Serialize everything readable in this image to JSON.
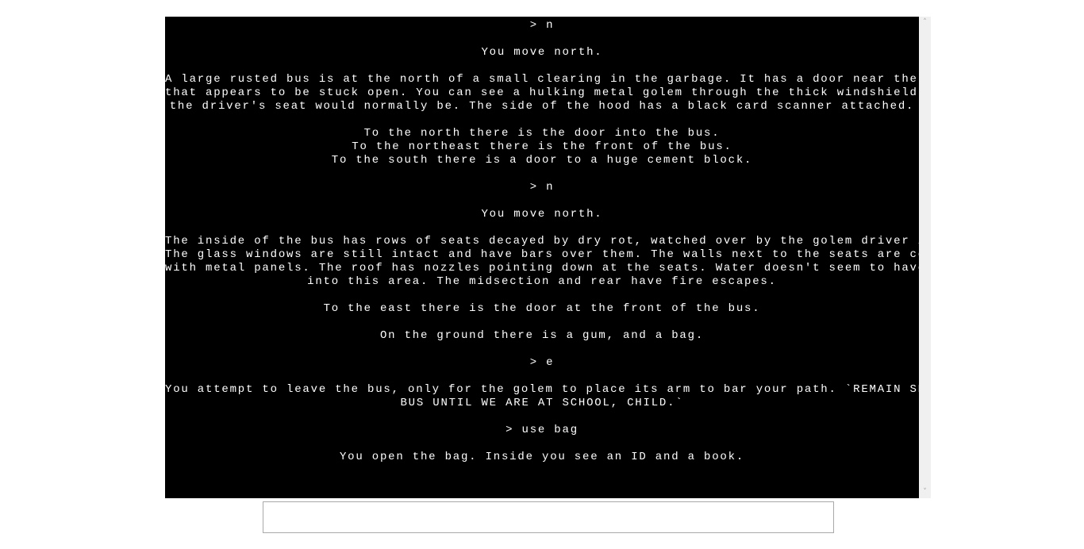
{
  "output": [
    {
      "kind": "command",
      "lines": [
        "> n"
      ]
    },
    {
      "kind": "text",
      "lines": [
        "You move north."
      ]
    },
    {
      "kind": "text",
      "lines": [
        "A large rusted bus is at the north of a small clearing in the garbage. It has a door near the front",
        "that appears to be stuck open. You can see a hulking metal golem through the thick windshield where",
        "the driver's seat would normally be. The side of the hood has a black card scanner attached."
      ]
    },
    {
      "kind": "text",
      "lines": [
        "To the north there is the door into the bus.",
        "To the northeast there is the front of the bus.",
        "To the south there is a door to a huge cement block."
      ]
    },
    {
      "kind": "command",
      "lines": [
        "> n"
      ]
    },
    {
      "kind": "text",
      "lines": [
        "You move north."
      ]
    },
    {
      "kind": "text",
      "lines": [
        "The inside of the bus has rows of seats decayed by dry rot, watched over by the golem driver in front.",
        "The glass windows are still intact and have bars over them. The walls next to the seats are covered",
        "with metal panels. The roof has nozzles pointing down at the seats. Water doesn't seem to have gotten",
        "into this area. The midsection and rear have fire escapes."
      ]
    },
    {
      "kind": "text",
      "lines": [
        "To the east there is the door at the front of the bus."
      ]
    },
    {
      "kind": "text",
      "lines": [
        "On the ground there is a gum, and a bag."
      ]
    },
    {
      "kind": "command",
      "lines": [
        "> e"
      ]
    },
    {
      "kind": "text",
      "lines": [
        "You attempt to leave the bus, only for the golem to place its arm to bar your path. `REMAIN SEATED ON",
        "BUS UNTIL WE ARE AT SCHOOL, CHILD.`"
      ]
    },
    {
      "kind": "command",
      "lines": [
        "> use bag"
      ]
    },
    {
      "kind": "text",
      "lines": [
        "You open the bag. Inside you see an ID and a book."
      ]
    }
  ],
  "input": {
    "value": ""
  },
  "scrollbar": {
    "up_icon": "chevron-up-icon",
    "down_icon": "chevron-down-icon"
  }
}
